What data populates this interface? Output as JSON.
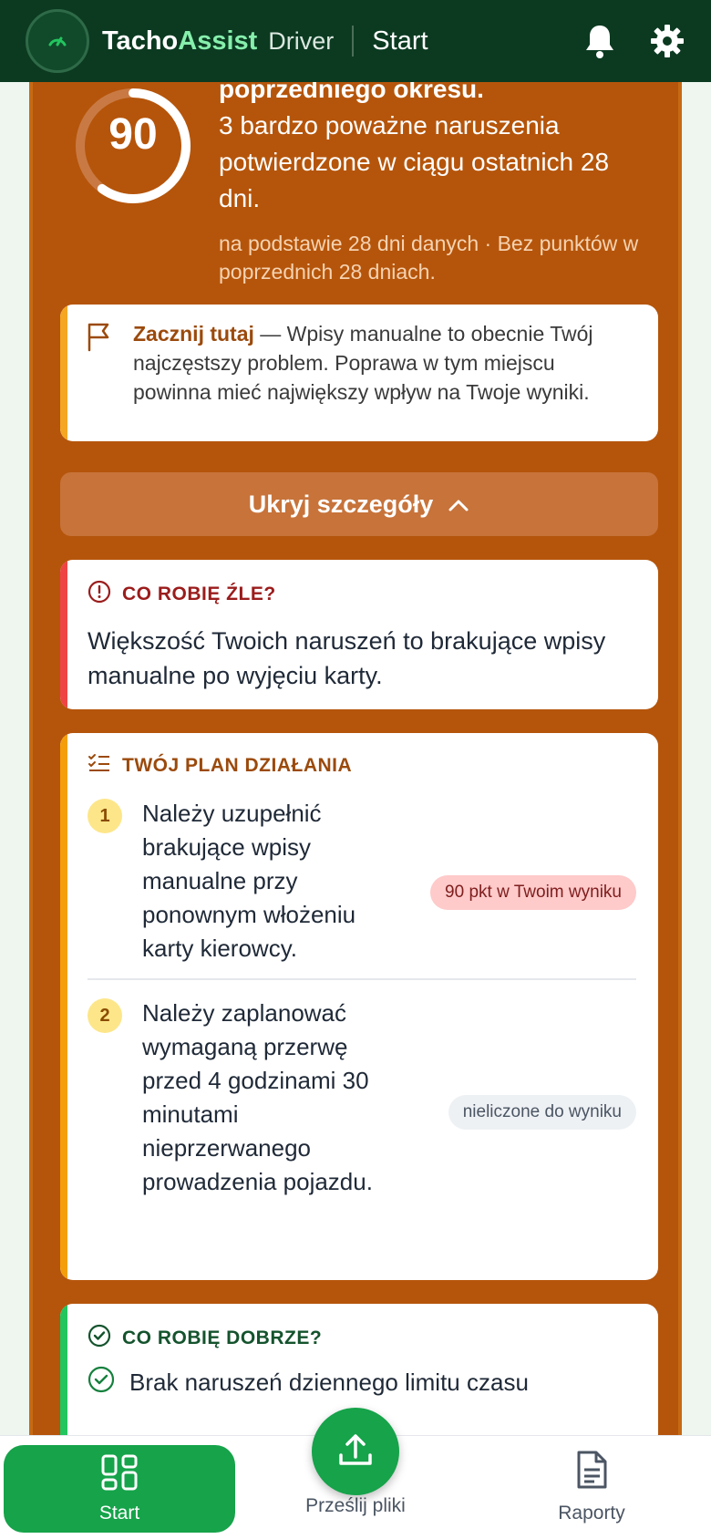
{
  "topbar": {
    "brand_main": "Tacho",
    "brand_accent": "Assist",
    "brand_sub": "Driver",
    "page_title": "Start",
    "icons": [
      "speedometer-logo-icon",
      "bell-icon",
      "gear-icon"
    ]
  },
  "score": {
    "value": "90",
    "gauge_fraction": 0.6,
    "heading_cut": "poprzedniego okresu.",
    "description": "3 bardzo poważne naruszenia potwierdzone w ciągu ostatnich 28 dni.",
    "basis": "na podstawie 28 dni danych · Bez punktów w poprzednich 28 dniach."
  },
  "start_here": {
    "lead": "Zacznij tutaj",
    "text": " — Wpisy manualne to obecnie Twój najczęstszy problem. Poprawa w tym miejscu powinna mieć największy wpływ na Twoje wyniki.",
    "icon": "flag-icon"
  },
  "toggle": {
    "label": "Ukryj szczegóły",
    "icon": "chevron-up-icon"
  },
  "wrong": {
    "title": "CO ROBIĘ ŹLE?",
    "text": "Większość Twoich naruszeń to brakujące wpisy manualne po wyjęciu karty."
  },
  "plan": {
    "title": "TWÓJ PLAN DZIAŁANIA",
    "items": [
      {
        "num": "1",
        "text": "Należy uzupełnić brakujące wpisy manualne przy ponownym włożeniu karty kierowcy.",
        "pill": "90 pkt w Twoim wyniku"
      },
      {
        "num": "2",
        "text": "Należy zaplanować wymaganą przerwę przed 4 godzinami 30 minutami nieprzerwanego prowadzenia pojazdu.",
        "pill": "nieliczone do wyniku"
      }
    ]
  },
  "good": {
    "title": "CO ROBIĘ DOBRZE?",
    "item_visible": "Brak naruszeń dziennego limitu czasu"
  },
  "bottom_nav": {
    "start": "Start",
    "upload": "Prześlij pliki",
    "reports": "Raporty"
  },
  "colors": {
    "topbar": "#0b3a21",
    "panel": "#b5550b",
    "accent_green": "#16a34a",
    "danger": "#9b1c1c"
  }
}
